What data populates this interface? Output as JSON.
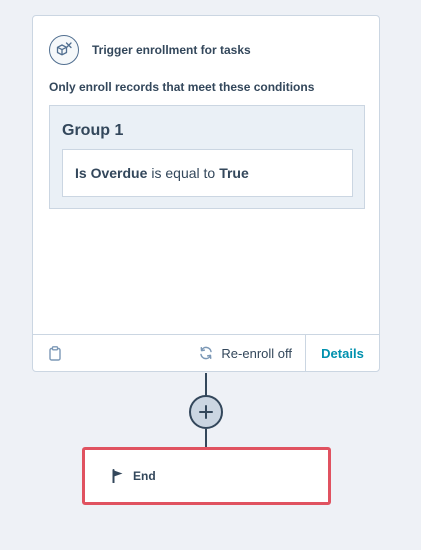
{
  "trigger": {
    "title": "Trigger enrollment for tasks",
    "conditions_label": "Only enroll records that meet these conditions",
    "group": {
      "title": "Group 1",
      "condition": {
        "property": "Is Overdue",
        "operator": "is equal to",
        "value": "True"
      }
    },
    "footer": {
      "reenroll_label": "Re-enroll off",
      "details_label": "Details"
    }
  },
  "end_node": {
    "label": "End"
  },
  "icons": {
    "trigger": "cube-trigger-icon",
    "clipboard": "clipboard-icon",
    "reenroll": "refresh-icon",
    "add": "plus-icon",
    "end": "flag-icon"
  },
  "colors": {
    "accent_link": "#0091ae",
    "text": "#33475b",
    "border": "#cbd6e2",
    "selected_outline": "#e05260",
    "background": "#eef1f6"
  }
}
